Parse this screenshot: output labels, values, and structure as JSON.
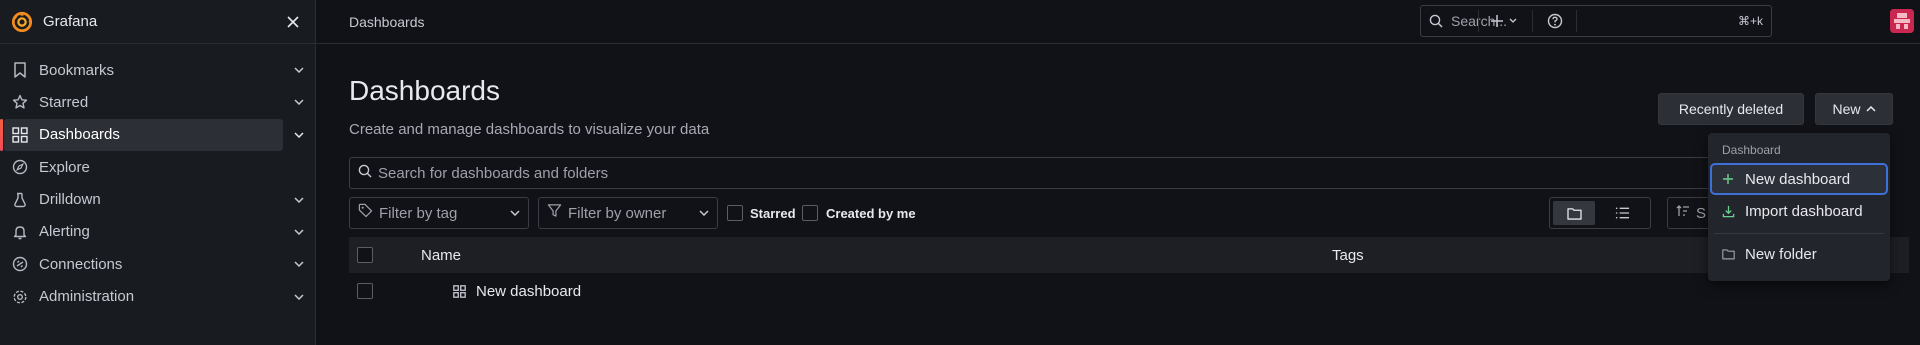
{
  "app": {
    "brand": "Grafana",
    "accent": "#f55f3e",
    "focus_color": "#3d71d9"
  },
  "sidebar": {
    "items": [
      {
        "label": "Bookmarks",
        "icon": "bookmark-icon",
        "has_chevron": true
      },
      {
        "label": "Starred",
        "icon": "star-icon",
        "has_chevron": true
      },
      {
        "label": "Dashboards",
        "icon": "apps-icon",
        "has_chevron": true,
        "active": true
      },
      {
        "label": "Explore",
        "icon": "compass-icon",
        "has_chevron": false
      },
      {
        "label": "Drilldown",
        "icon": "drilldown-icon",
        "has_chevron": true
      },
      {
        "label": "Alerting",
        "icon": "bell-icon",
        "has_chevron": true
      },
      {
        "label": "Connections",
        "icon": "connections-icon",
        "has_chevron": true
      },
      {
        "label": "Administration",
        "icon": "cog-icon",
        "has_chevron": true
      }
    ]
  },
  "topbar": {
    "breadcrumb": "Dashboards",
    "search_placeholder": "Search...",
    "search_shortcut": "⌘+k"
  },
  "main": {
    "title": "Dashboards",
    "subtitle": "Create and manage dashboards to visualize your data",
    "recently_deleted_label": "Recently deleted",
    "new_label": "New",
    "search_placeholder": "Search for dashboards and folders",
    "filter_tag": "Filter by tag",
    "filter_owner": "Filter by owner",
    "starred_label": "Starred",
    "created_by_me_label": "Created by me",
    "sort_partial": "S",
    "table": {
      "col_name": "Name",
      "col_tags": "Tags",
      "rows": [
        {
          "name": "New dashboard"
        }
      ]
    }
  },
  "new_menu": {
    "section_header": "Dashboard",
    "items": [
      {
        "label": "New dashboard",
        "icon": "plus-icon"
      },
      {
        "label": "Import dashboard",
        "icon": "import-icon"
      },
      {
        "label": "New folder",
        "icon": "folder-icon"
      }
    ]
  }
}
